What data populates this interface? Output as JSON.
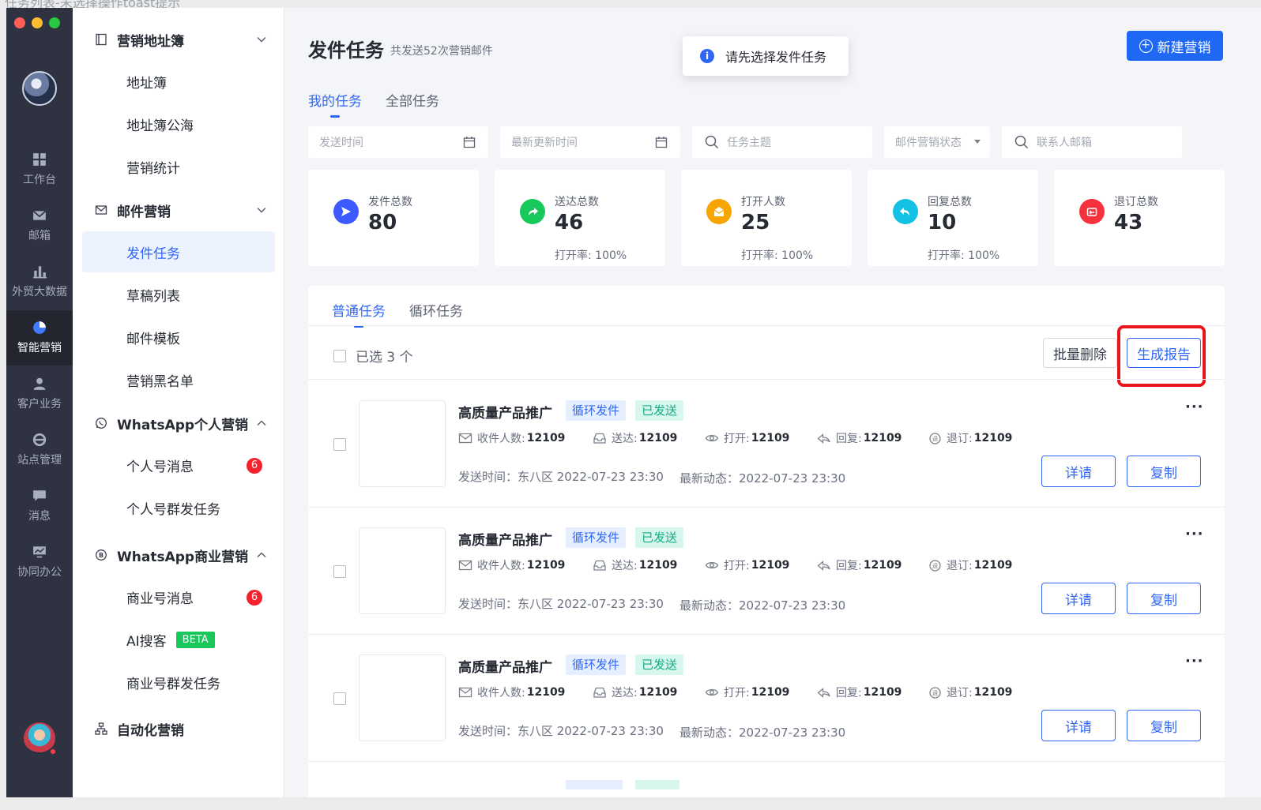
{
  "caption": "任务列表-未选择操作toast提示",
  "rail": {
    "items": [
      {
        "label": "工作台",
        "icon": "dashboard-icon"
      },
      {
        "label": "邮箱",
        "icon": "mail-icon"
      },
      {
        "label": "外贸大数据",
        "icon": "bar-chart-icon"
      },
      {
        "label": "智能营销",
        "icon": "pie-chart-icon"
      },
      {
        "label": "客户业务",
        "icon": "user-icon"
      },
      {
        "label": "站点管理",
        "icon": "browser-icon"
      },
      {
        "label": "消息",
        "icon": "message-icon"
      },
      {
        "label": "协同办公",
        "icon": "monitor-icon"
      }
    ]
  },
  "sidebar": {
    "group1": {
      "label": "营销地址簿"
    },
    "g1_items": [
      "地址簿",
      "地址簿公海",
      "营销统计"
    ],
    "group2": {
      "label": "邮件营销"
    },
    "g2_items": [
      "发件任务",
      "草稿列表",
      "邮件模板",
      "营销黑名单"
    ],
    "group3": {
      "label": "WhatsApp个人营销"
    },
    "g3_items": [
      "个人号消息",
      "个人号群发任务"
    ],
    "group3_badge": "6",
    "group4": {
      "label": "WhatsApp商业营销"
    },
    "g4_items": [
      "商业号消息",
      "AI搜客",
      "商业号群发任务"
    ],
    "group4_badge": "6",
    "beta": "BETA",
    "group5": {
      "label": "自动化营销"
    }
  },
  "header": {
    "title": "发件任务",
    "subtitle": "共发送52次营销邮件",
    "toast": "请先选择发件任务",
    "new_button": "新建营销"
  },
  "tabs": [
    "我的任务",
    "全部任务"
  ],
  "filters": {
    "send_time": "发送时间",
    "update_time": "最新更新时间",
    "subject": "任务主题",
    "status": "邮件营销状态",
    "email": "联系人邮箱"
  },
  "stats": [
    {
      "label": "发件总数",
      "value": "80",
      "rate": "",
      "color": "#3d5afe"
    },
    {
      "label": "送达总数",
      "value": "46",
      "rate": "打开率: 100%",
      "color": "#18c85a"
    },
    {
      "label": "打开人数",
      "value": "25",
      "rate": "打开率: 100%",
      "color": "#f7a500"
    },
    {
      "label": "回复总数",
      "value": "10",
      "rate": "打开率: 100%",
      "color": "#13c2e3"
    },
    {
      "label": "退订总数",
      "value": "43",
      "rate": "",
      "color": "#f5313e"
    }
  ],
  "panel": {
    "tabs": [
      "普通任务",
      "循环任务"
    ],
    "selected": "已选 3 个",
    "batch_delete": "批量删除",
    "generate_report": "生成报告"
  },
  "task_labels": {
    "tag_cycle": "循环发件",
    "tag_sent": "已发送",
    "recipients": "收件人数:",
    "delivered": "送达:",
    "opened": "打开:",
    "replied": "回复:",
    "unsub": "退订:",
    "detail": "详请",
    "copy": "复制",
    "more": "···"
  },
  "tasks": [
    {
      "name": "高质量产品推广",
      "recipients": "12109",
      "delivered": "12109",
      "opened": "12109",
      "replied": "12109",
      "unsub": "12109",
      "send_time": "发送时间：东八区 2022-07-23 23:30",
      "latest": "最新动态：2022-07-23 23:30"
    },
    {
      "name": "高质量产品推广",
      "recipients": "12109",
      "delivered": "12109",
      "opened": "12109",
      "replied": "12109",
      "unsub": "12109",
      "send_time": "发送时间：东八区 2022-07-23 23:30",
      "latest": "最新动态：2022-07-23 23:30"
    },
    {
      "name": "高质量产品推广",
      "recipients": "12109",
      "delivered": "12109",
      "opened": "12109",
      "replied": "12109",
      "unsub": "12109",
      "send_time": "发送时间：东八区 2022-07-23 23:30",
      "latest": "最新动态：2022-07-23 23:30"
    }
  ]
}
